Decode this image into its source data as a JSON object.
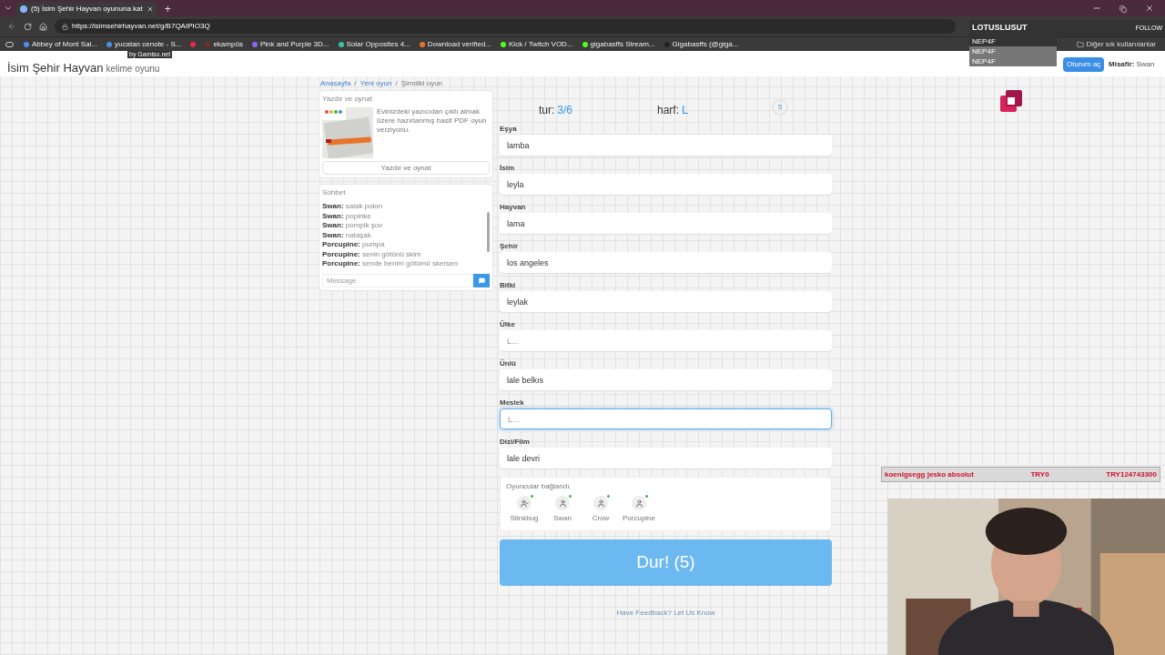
{
  "browser": {
    "tabs": [
      {
        "title": "(5) İsim Şehir Hayvan oyununa kat",
        "selected": true
      }
    ],
    "new_tab": "+",
    "url": "https://isimsehirhayvan.net/g/B7QAIPIO3Q",
    "bookmarks": [
      {
        "label": "Abbey of Mont Sai...",
        "color": "#4a8fe8"
      },
      {
        "label": "yucatan cenote - S...",
        "color": "#4a8fe8"
      },
      {
        "color": "#e8294a"
      },
      {
        "label": "ekampüs",
        "color": "#7a2a2a"
      },
      {
        "label": "Pink and Purple 3D...",
        "color": "#8a6ae8"
      },
      {
        "label": "Solar Opposites 4...",
        "color": "#3ac4a4"
      },
      {
        "label": "Download verified...",
        "color": "#e8742a"
      },
      {
        "label": "Kick / Twitch VOD...",
        "color": "#53fc18"
      },
      {
        "label": "gigabasffs Stream...",
        "color": "#53fc18"
      },
      {
        "label": "Gigabasffs (@giga...",
        "color": "#222222"
      }
    ],
    "other_bookmarks": "Diğer sık kullanılanlar"
  },
  "site": {
    "badge": "by Gamiso.net",
    "title": "İsim Şehir Hayvan",
    "subtitle": "kelime oyunu",
    "login": "Oturum aç",
    "guest_label": "Misafir:",
    "guest_name": "Swan"
  },
  "breadcrumb": [
    {
      "label": "Anasayfa",
      "link": true
    },
    {
      "separator": "/"
    },
    {
      "label": "Yeni oyun",
      "link": true
    },
    {
      "separator": "/"
    },
    {
      "label": "Şimdiki oyun",
      "link": false
    }
  ],
  "print_card": {
    "title": "Yazdır ve oynat",
    "text": "Evinizdeki yazıcıdan çıktı almak üzere hazırlanmış basit PDF oyun verziyonu.",
    "button": "Yazdır ve oynat"
  },
  "chat": {
    "title": "Sohbet",
    "messages": [
      {
        "name": "Swan:",
        "text": "salak polon"
      },
      {
        "name": "Swan:",
        "text": "popinke"
      },
      {
        "name": "Swan:",
        "text": "pompik şov"
      },
      {
        "name": "Swan:",
        "text": "nataşak"
      },
      {
        "name": "Porcupine:",
        "text": "pumpa"
      },
      {
        "name": "Porcupine:",
        "text": "senin götünü skim"
      },
      {
        "name": "Porcupine:",
        "text": "sende benim götümü skersen"
      }
    ],
    "placeholder": "Message"
  },
  "round": {
    "label": "tur:",
    "value": "3/6",
    "letter_label": "harf:",
    "letter": "L",
    "timer": "5"
  },
  "fields": [
    {
      "label": "Eşya",
      "value": "lamba",
      "focused": false
    },
    {
      "label": "İsim",
      "value": "leyla",
      "focused": false
    },
    {
      "label": "Hayvan",
      "value": "lama",
      "focused": false
    },
    {
      "label": "Şehir",
      "value": "los angeles",
      "focused": false
    },
    {
      "label": "Bitki",
      "value": "leylak",
      "focused": false
    },
    {
      "label": "Ülke",
      "placeholder": "L...",
      "focused": false
    },
    {
      "label": "Ünlü",
      "value": "lale belkıs",
      "focused": false
    },
    {
      "label": "Meslek",
      "placeholder": "L...",
      "focused": true
    },
    {
      "label": "Dizi/Film",
      "value": "lale devri",
      "focused": false
    }
  ],
  "players": {
    "title": "Oyuncular bağlandı.",
    "list": [
      {
        "name": "Stinkbug",
        "kind": "self",
        "online": true
      },
      {
        "name": "Swan",
        "kind": "other",
        "online": true
      },
      {
        "name": "Crow",
        "kind": "other",
        "online": true
      },
      {
        "name": "Porcupine",
        "kind": "other",
        "online": true
      }
    ]
  },
  "stop_button": "Dur! (5)",
  "feedback": "Have Feedback? Let Us Know",
  "overlay": {
    "channel": "LOTUSLUSUT",
    "follow": "FOLLOW",
    "names": [
      "NEP4F",
      "NEP4F",
      "NEP4F"
    ],
    "car": "koenigsegg jesko absolut",
    "price": "TRY0",
    "total": "TRY124743300"
  }
}
